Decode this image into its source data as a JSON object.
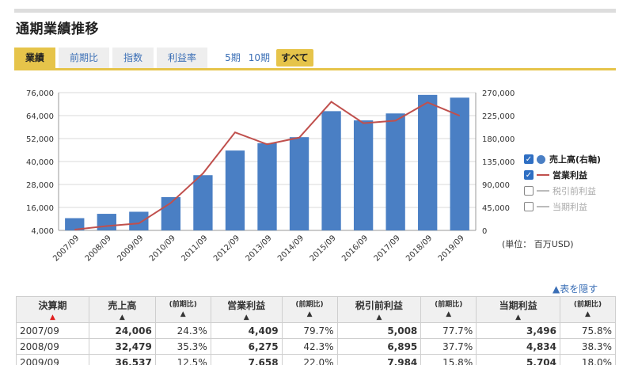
{
  "title": "通期業績推移",
  "tabs": [
    {
      "label": "業績",
      "active": true
    },
    {
      "label": "前期比",
      "active": false
    },
    {
      "label": "指数",
      "active": false
    },
    {
      "label": "利益率",
      "active": false
    }
  ],
  "periods": [
    {
      "label": "5期",
      "active": false
    },
    {
      "label": "10期",
      "active": false
    },
    {
      "label": "すべて",
      "active": true
    }
  ],
  "colors": {
    "bar": "#4a7fc4",
    "line": "#c0504d",
    "accent": "#e6c44a"
  },
  "chart_data": {
    "type": "bar",
    "categories": [
      "2007/09",
      "2008/09",
      "2009/09",
      "2010/09",
      "2011/09",
      "2012/09",
      "2013/09",
      "2014/09",
      "2015/09",
      "2016/09",
      "2017/09",
      "2018/09",
      "2019/09"
    ],
    "series": [
      {
        "name": "売上高(右軸)",
        "axis": "right",
        "kind": "bar",
        "values": [
          24006,
          32479,
          36537,
          65225,
          108249,
          156508,
          170910,
          182795,
          233715,
          215639,
          229234,
          265595,
          260174
        ]
      },
      {
        "name": "営業利益",
        "axis": "left",
        "kind": "line",
        "values": [
          4409,
          6275,
          7658,
          18385,
          33790,
          55241,
          48999,
          52503,
          71230,
          60024,
          61344,
          70898,
          63930
        ]
      }
    ],
    "left_ticks": [
      "4,000",
      "16,000",
      "28,000",
      "40,000",
      "52,000",
      "64,000",
      "76,000"
    ],
    "right_ticks": [
      "0",
      "45,000",
      "90,000",
      "135,000",
      "180,000",
      "225,000",
      "270,000"
    ],
    "left_range": [
      4000,
      76000
    ],
    "right_range": [
      0,
      270000
    ],
    "grid": true
  },
  "legend": [
    {
      "label": "売上高(右軸)",
      "checked": true,
      "marker": "dot"
    },
    {
      "label": "営業利益",
      "checked": true,
      "marker": "line"
    },
    {
      "label": "税引前利益",
      "checked": false,
      "marker": "line"
    },
    {
      "label": "当期利益",
      "checked": false,
      "marker": "line"
    }
  ],
  "unit": "(単位： 百万USD)",
  "hide_link": "▲表を隠す",
  "table": {
    "headers": [
      "決算期",
      "売上高",
      "(前期比)",
      "営業利益",
      "(前期比)",
      "税引前利益",
      "(前期比)",
      "当期利益",
      "(前期比)"
    ],
    "sort_arrows": [
      "▲",
      "▲",
      "▲",
      "▲",
      "▲",
      "▲",
      "▲",
      "▲",
      "▲"
    ],
    "rows": [
      [
        "2007/09",
        "24,006",
        "24.3%",
        "4,409",
        "79.7%",
        "5,008",
        "77.7%",
        "3,496",
        "75.8%"
      ],
      [
        "2008/09",
        "32,479",
        "35.3%",
        "6,275",
        "42.3%",
        "6,895",
        "37.7%",
        "4,834",
        "38.3%"
      ],
      [
        "2009/09",
        "36,537",
        "12.5%",
        "7,658",
        "22.0%",
        "7,984",
        "15.8%",
        "5,704",
        "18.0%"
      ]
    ]
  }
}
